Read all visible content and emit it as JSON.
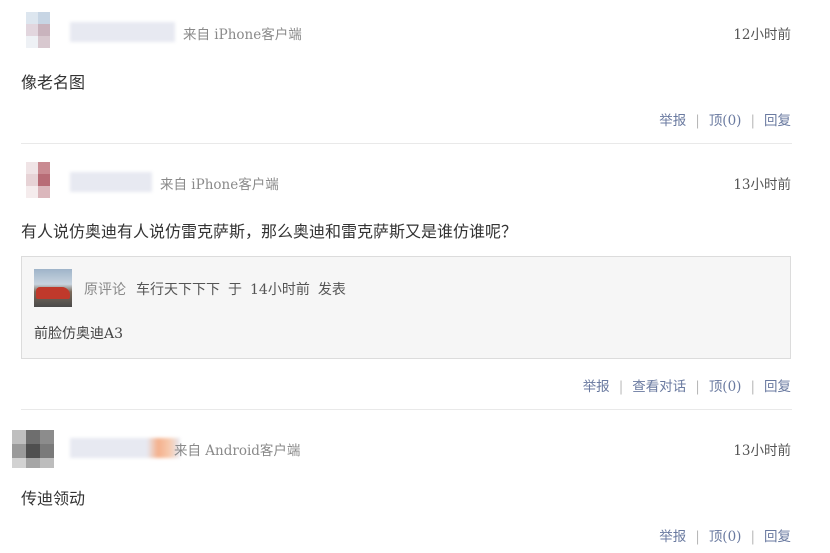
{
  "comments": [
    {
      "source": "来自 iPhone客户端",
      "time": "12小时前",
      "text": "像老名图",
      "actions": {
        "report": "举报",
        "up": "顶(0)",
        "reply": "回复"
      }
    },
    {
      "source": "来自 iPhone客户端",
      "time": "13小时前",
      "text": "有人说仿奥迪有人说仿雷克萨斯，那么奥迪和雷克萨斯又是谁仿谁呢？",
      "quote": {
        "label": "原评论",
        "author": "车行天下下下",
        "preposition": "于",
        "time": "14小时前",
        "verb": "发表",
        "text": "前脸仿奥迪A3"
      },
      "actions": {
        "report": "举报",
        "view_conversation": "查看对话",
        "up": "顶(0)",
        "reply": "回复"
      }
    },
    {
      "source": "来自 Android客户端",
      "time": "13小时前",
      "text": "传迪领动",
      "actions": {
        "report": "举报",
        "up": "顶(0)",
        "reply": "回复"
      }
    }
  ]
}
